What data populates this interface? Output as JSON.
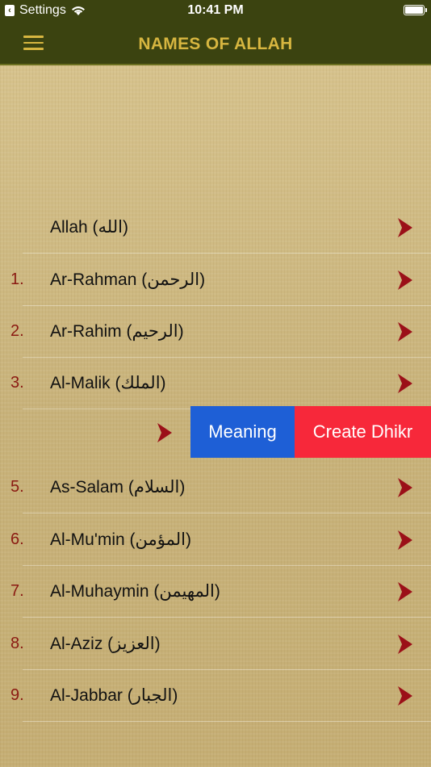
{
  "status_bar": {
    "back_app": "Settings",
    "time": "10:41 PM",
    "back_icon": "back-chevron-icon",
    "wifi_icon": "wifi-icon",
    "battery_icon": "battery-icon"
  },
  "nav": {
    "title": "NAMES OF ALLAH",
    "menu_icon": "hamburger-menu-icon"
  },
  "colors": {
    "bar": "#3b4310",
    "title": "#d7b640",
    "number": "#8b1a12",
    "chevron": "#9b1018",
    "meaning": "#1e5fd6",
    "create_dhikr": "#f7283a"
  },
  "rows": [
    {
      "num": "",
      "name": "Allah (الله)"
    },
    {
      "num": "1.",
      "name": "Ar-Rahman (الرحمن)"
    },
    {
      "num": "2.",
      "name": "Ar-Rahim (الرحيم)"
    },
    {
      "num": "3.",
      "name": "Al-Malik (الملك)"
    }
  ],
  "swipe_actions": {
    "meaning": "Meaning",
    "create_dhikr": "Create Dhikr"
  },
  "rows_after": [
    {
      "num": "5.",
      "name": "As-Salam (السلام)"
    },
    {
      "num": "6.",
      "name": "Al-Mu'min (المؤمن)"
    },
    {
      "num": "7.",
      "name": "Al-Muhaymin (المهيمن)"
    },
    {
      "num": "8.",
      "name": "Al-Aziz (العزيز)"
    },
    {
      "num": "9.",
      "name": "Al-Jabbar (الجبار)"
    }
  ]
}
